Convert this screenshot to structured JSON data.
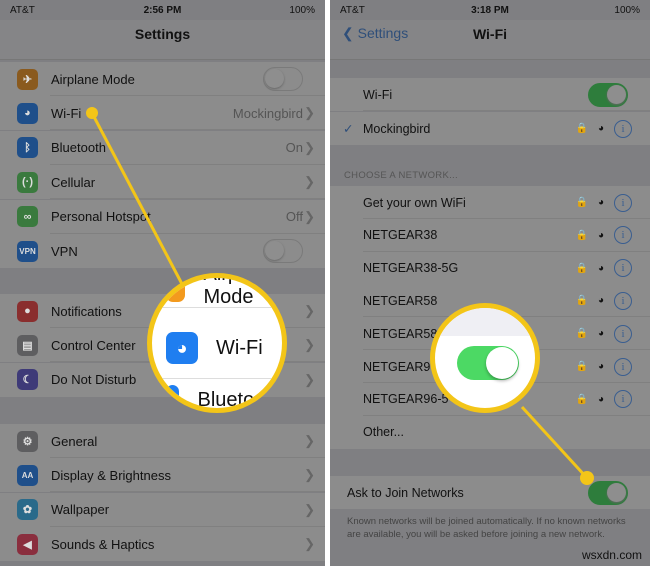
{
  "left": {
    "status": {
      "carrier": "AT&T",
      "time": "2:56 PM",
      "battery": "100%"
    },
    "title": "Settings",
    "groups": [
      [
        {
          "label": "Airplane Mode",
          "icon": "airplane-icon",
          "color": "#8a5a1e",
          "control": "switch",
          "on": false
        },
        {
          "label": "Wi-Fi",
          "icon": "wifi-icon",
          "color": "#1f4f8a",
          "value": "Mockingbird",
          "control": "chevron"
        },
        {
          "label": "Bluetooth",
          "icon": "bluetooth-icon",
          "color": "#1f4f8a",
          "value": "On",
          "control": "chevron"
        },
        {
          "label": "Cellular",
          "icon": "cellular-icon",
          "color": "#3a7a3e",
          "control": "chevron"
        },
        {
          "label": "Personal Hotspot",
          "icon": "hotspot-icon",
          "color": "#3a7a3e",
          "value": "Off",
          "control": "chevron"
        },
        {
          "label": "VPN",
          "icon": "vpn-icon",
          "color": "#1f4f8a",
          "icon_text": "VPN",
          "control": "switch",
          "on": false
        }
      ],
      [
        {
          "label": "Notifications",
          "icon": "notifications-icon",
          "color": "#8a2e2e",
          "control": "chevron"
        },
        {
          "label": "Control Center",
          "icon": "control-center-icon",
          "color": "#5e5e60",
          "control": "chevron"
        },
        {
          "label": "Do Not Disturb",
          "icon": "moon-icon",
          "color": "#3e3a78",
          "control": "chevron"
        }
      ],
      [
        {
          "label": "General",
          "icon": "gear-icon",
          "color": "#5e5e60",
          "control": "chevron"
        },
        {
          "label": "Display & Brightness",
          "icon": "display-icon",
          "color": "#1f4f8a",
          "icon_text": "AA",
          "control": "chevron"
        },
        {
          "label": "Wallpaper",
          "icon": "wallpaper-icon",
          "color": "#2a6a8a",
          "control": "chevron"
        },
        {
          "label": "Sounds & Haptics",
          "icon": "sounds-icon",
          "color": "#8a2e3e",
          "control": "chevron"
        }
      ]
    ],
    "magnifier": {
      "rows": [
        "Airplane Mode",
        "Wi-Fi",
        "Bluetooth"
      ]
    }
  },
  "right": {
    "status": {
      "carrier": "AT&T",
      "time": "3:18 PM",
      "battery": "100%"
    },
    "back_label": "Settings",
    "title": "Wi-Fi",
    "wifi_label": "Wi-Fi",
    "wifi_on": true,
    "connected": "Mockingbird",
    "section_label": "CHOOSE A NETWORK...",
    "networks": [
      "Get your own WiFi",
      "NETGEAR38",
      "NETGEAR38-5G",
      "NETGEAR58",
      "NETGEAR58",
      "NETGEAR9",
      "NETGEAR96-5"
    ],
    "other_label": "Other...",
    "ask_label": "Ask to Join Networks",
    "ask_on": true,
    "footer": "Known networks will be joined automatically. If no known networks are available, you will be asked before joining a new network."
  },
  "accent": "#f3c518",
  "watermark": "wsxdn.com"
}
